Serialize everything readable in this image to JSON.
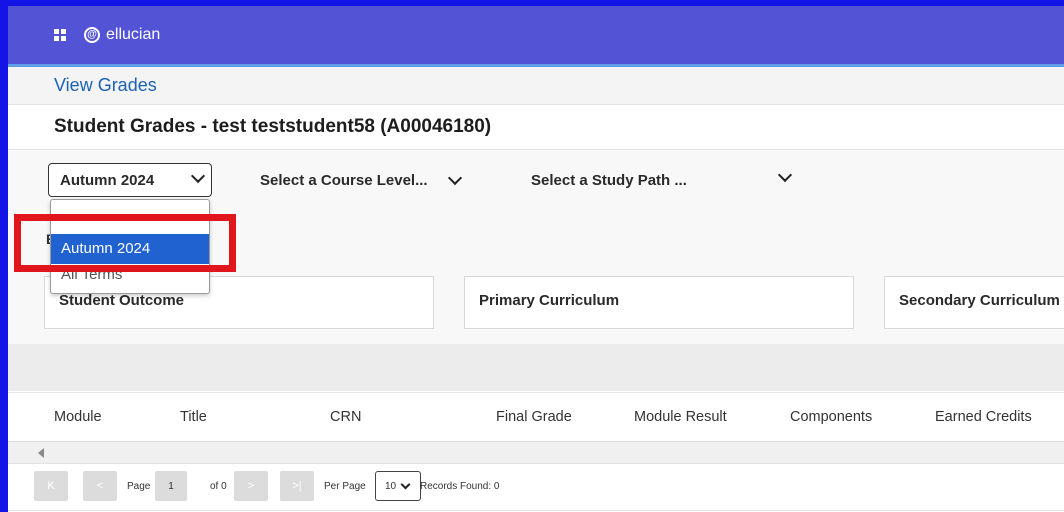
{
  "brand": {
    "name": "ellucian",
    "logo_glyph": "@"
  },
  "breadcrumb": {
    "label": "View Grades"
  },
  "page": {
    "title": "Student Grades - test teststudent58 (A00046180)"
  },
  "filters": {
    "term": {
      "value": "Autumn 2024"
    },
    "course_level": {
      "placeholder": "Select a Course Level..."
    },
    "study_path": {
      "placeholder": "Select a Study Path ..."
    }
  },
  "term_dropdown": {
    "options": [
      "Autumn 2024",
      "All Terms"
    ],
    "selected_index": 0
  },
  "hidden_label_initial": "E",
  "cards": {
    "outcome": "Student Outcome",
    "primary": "Primary Curriculum",
    "secondary": "Secondary Curriculum"
  },
  "table": {
    "columns": [
      "Module",
      "Title",
      "CRN",
      "Final Grade",
      "Module Result",
      "Components",
      "Earned Credits"
    ]
  },
  "pagination": {
    "first": "K",
    "prev": "<",
    "next": ">",
    "last": ">|",
    "page_label": "Page",
    "page_value": "1",
    "of_label": "of 0",
    "per_page_label": "Per Page",
    "per_page_value": "10",
    "records_label": "Records Found: 0"
  },
  "colors": {
    "brand_bar": "#5353d6",
    "frame": "#1414e6",
    "selected_option": "#1f62d0",
    "highlight": "#e0161c",
    "link": "#1a62b5"
  }
}
